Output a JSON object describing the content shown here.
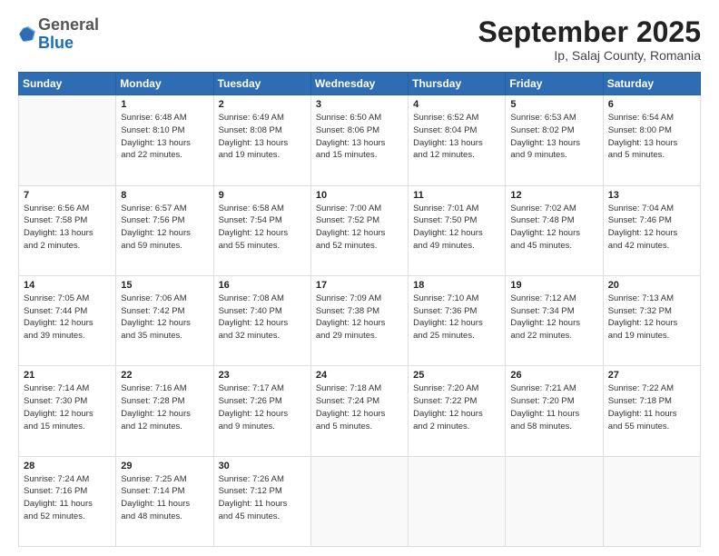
{
  "header": {
    "logo_line1": "General",
    "logo_line2": "Blue",
    "month": "September 2025",
    "location": "Ip, Salaj County, Romania"
  },
  "weekdays": [
    "Sunday",
    "Monday",
    "Tuesday",
    "Wednesday",
    "Thursday",
    "Friday",
    "Saturday"
  ],
  "weeks": [
    [
      {
        "day": "",
        "info": ""
      },
      {
        "day": "1",
        "info": "Sunrise: 6:48 AM\nSunset: 8:10 PM\nDaylight: 13 hours\nand 22 minutes."
      },
      {
        "day": "2",
        "info": "Sunrise: 6:49 AM\nSunset: 8:08 PM\nDaylight: 13 hours\nand 19 minutes."
      },
      {
        "day": "3",
        "info": "Sunrise: 6:50 AM\nSunset: 8:06 PM\nDaylight: 13 hours\nand 15 minutes."
      },
      {
        "day": "4",
        "info": "Sunrise: 6:52 AM\nSunset: 8:04 PM\nDaylight: 13 hours\nand 12 minutes."
      },
      {
        "day": "5",
        "info": "Sunrise: 6:53 AM\nSunset: 8:02 PM\nDaylight: 13 hours\nand 9 minutes."
      },
      {
        "day": "6",
        "info": "Sunrise: 6:54 AM\nSunset: 8:00 PM\nDaylight: 13 hours\nand 5 minutes."
      }
    ],
    [
      {
        "day": "7",
        "info": "Sunrise: 6:56 AM\nSunset: 7:58 PM\nDaylight: 13 hours\nand 2 minutes."
      },
      {
        "day": "8",
        "info": "Sunrise: 6:57 AM\nSunset: 7:56 PM\nDaylight: 12 hours\nand 59 minutes."
      },
      {
        "day": "9",
        "info": "Sunrise: 6:58 AM\nSunset: 7:54 PM\nDaylight: 12 hours\nand 55 minutes."
      },
      {
        "day": "10",
        "info": "Sunrise: 7:00 AM\nSunset: 7:52 PM\nDaylight: 12 hours\nand 52 minutes."
      },
      {
        "day": "11",
        "info": "Sunrise: 7:01 AM\nSunset: 7:50 PM\nDaylight: 12 hours\nand 49 minutes."
      },
      {
        "day": "12",
        "info": "Sunrise: 7:02 AM\nSunset: 7:48 PM\nDaylight: 12 hours\nand 45 minutes."
      },
      {
        "day": "13",
        "info": "Sunrise: 7:04 AM\nSunset: 7:46 PM\nDaylight: 12 hours\nand 42 minutes."
      }
    ],
    [
      {
        "day": "14",
        "info": "Sunrise: 7:05 AM\nSunset: 7:44 PM\nDaylight: 12 hours\nand 39 minutes."
      },
      {
        "day": "15",
        "info": "Sunrise: 7:06 AM\nSunset: 7:42 PM\nDaylight: 12 hours\nand 35 minutes."
      },
      {
        "day": "16",
        "info": "Sunrise: 7:08 AM\nSunset: 7:40 PM\nDaylight: 12 hours\nand 32 minutes."
      },
      {
        "day": "17",
        "info": "Sunrise: 7:09 AM\nSunset: 7:38 PM\nDaylight: 12 hours\nand 29 minutes."
      },
      {
        "day": "18",
        "info": "Sunrise: 7:10 AM\nSunset: 7:36 PM\nDaylight: 12 hours\nand 25 minutes."
      },
      {
        "day": "19",
        "info": "Sunrise: 7:12 AM\nSunset: 7:34 PM\nDaylight: 12 hours\nand 22 minutes."
      },
      {
        "day": "20",
        "info": "Sunrise: 7:13 AM\nSunset: 7:32 PM\nDaylight: 12 hours\nand 19 minutes."
      }
    ],
    [
      {
        "day": "21",
        "info": "Sunrise: 7:14 AM\nSunset: 7:30 PM\nDaylight: 12 hours\nand 15 minutes."
      },
      {
        "day": "22",
        "info": "Sunrise: 7:16 AM\nSunset: 7:28 PM\nDaylight: 12 hours\nand 12 minutes."
      },
      {
        "day": "23",
        "info": "Sunrise: 7:17 AM\nSunset: 7:26 PM\nDaylight: 12 hours\nand 9 minutes."
      },
      {
        "day": "24",
        "info": "Sunrise: 7:18 AM\nSunset: 7:24 PM\nDaylight: 12 hours\nand 5 minutes."
      },
      {
        "day": "25",
        "info": "Sunrise: 7:20 AM\nSunset: 7:22 PM\nDaylight: 12 hours\nand 2 minutes."
      },
      {
        "day": "26",
        "info": "Sunrise: 7:21 AM\nSunset: 7:20 PM\nDaylight: 11 hours\nand 58 minutes."
      },
      {
        "day": "27",
        "info": "Sunrise: 7:22 AM\nSunset: 7:18 PM\nDaylight: 11 hours\nand 55 minutes."
      }
    ],
    [
      {
        "day": "28",
        "info": "Sunrise: 7:24 AM\nSunset: 7:16 PM\nDaylight: 11 hours\nand 52 minutes."
      },
      {
        "day": "29",
        "info": "Sunrise: 7:25 AM\nSunset: 7:14 PM\nDaylight: 11 hours\nand 48 minutes."
      },
      {
        "day": "30",
        "info": "Sunrise: 7:26 AM\nSunset: 7:12 PM\nDaylight: 11 hours\nand 45 minutes."
      },
      {
        "day": "",
        "info": ""
      },
      {
        "day": "",
        "info": ""
      },
      {
        "day": "",
        "info": ""
      },
      {
        "day": "",
        "info": ""
      }
    ]
  ]
}
